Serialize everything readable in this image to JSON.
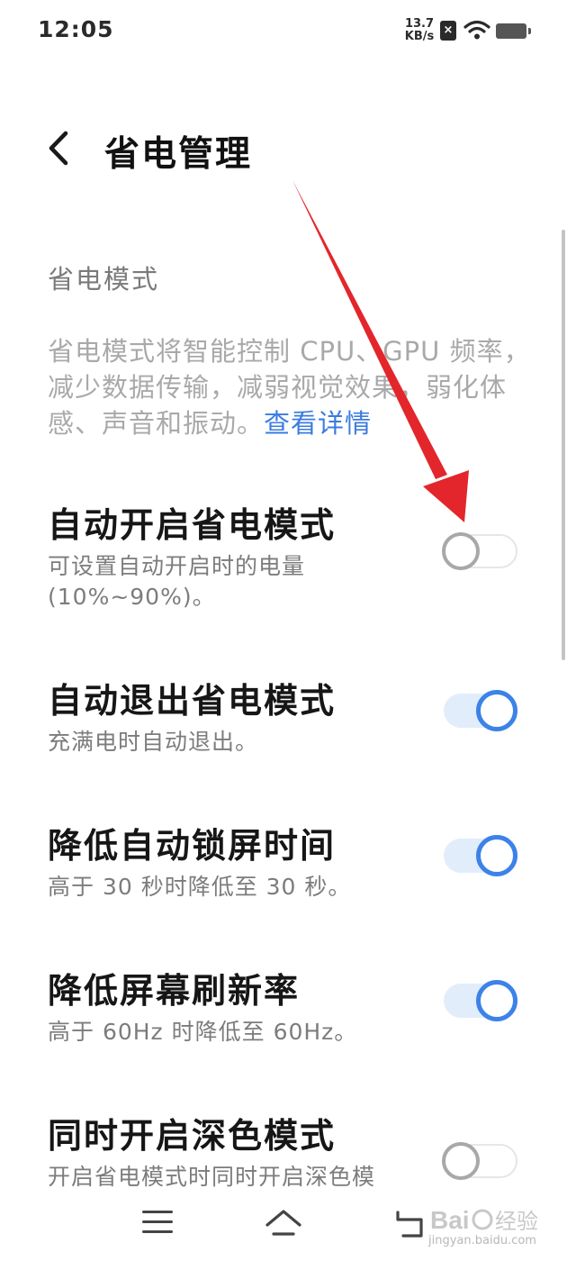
{
  "status_bar": {
    "time": "12:05",
    "speed_value": "13.7",
    "speed_unit": "KB/s",
    "icons": [
      "no-sim-icon",
      "wifi-icon",
      "battery-icon"
    ]
  },
  "header": {
    "title": "省电管理",
    "back_icon": "chevron-left-icon"
  },
  "section": {
    "title": "省电模式",
    "description": "省电模式将智能控制 CPU、GPU 频率，减少数据传输，减弱视觉效果，弱化体感、声音和振动。",
    "link": "查看详情"
  },
  "settings": [
    {
      "title": "自动开启省电模式",
      "subtitle": "可设置自动开启时的电量(10%~90%)。",
      "enabled": false
    },
    {
      "title": "自动退出省电模式",
      "subtitle": "充满电时自动退出。",
      "enabled": true
    },
    {
      "title": "降低自动锁屏时间",
      "subtitle": "高于 30 秒时降低至 30 秒。",
      "enabled": true
    },
    {
      "title": "降低屏幕刷新率",
      "subtitle": "高于 60Hz 时降低至 60Hz。",
      "enabled": true
    },
    {
      "title": "同时开启深色模式",
      "subtitle": "开启省电模式时同时开启深色模",
      "enabled": false
    }
  ],
  "colors": {
    "accent": "#3c82e8",
    "annotation_arrow": "#e3262b"
  },
  "nav_bar": {
    "icons": [
      "menu-icon",
      "home-icon",
      "back-icon"
    ]
  },
  "watermark": {
    "text": "jingyan.baidu.com"
  }
}
